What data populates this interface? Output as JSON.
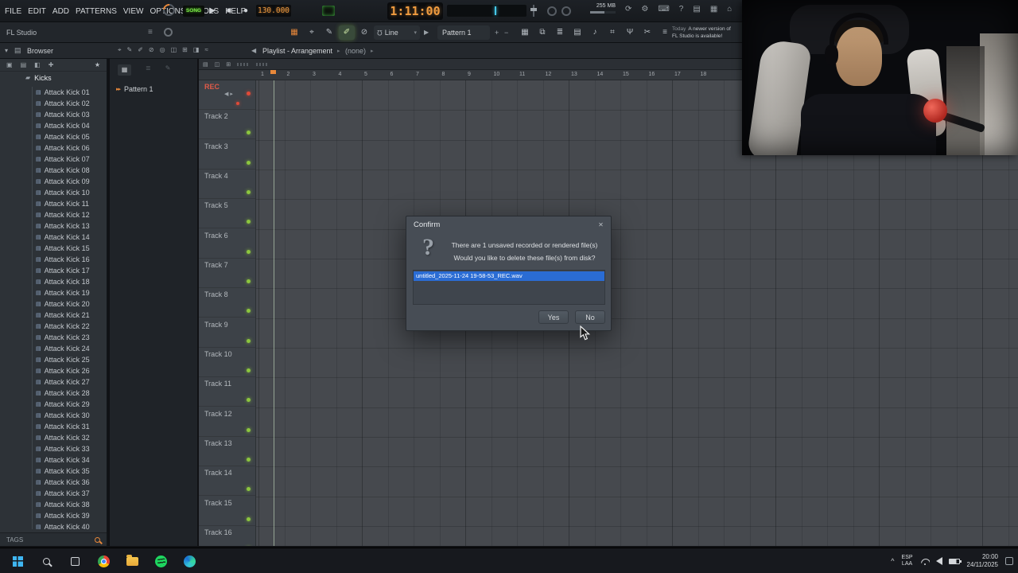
{
  "app": {
    "title": "FL Studio"
  },
  "menu": {
    "items": [
      "FILE",
      "EDIT",
      "ADD",
      "PATTERNS",
      "VIEW",
      "OPTIONS",
      "TOOLS",
      "HELP"
    ]
  },
  "transport": {
    "mode_label": "SONG",
    "play_icon": "▶",
    "stop_icon": "■",
    "record_icon": "●",
    "tempo": "130.000",
    "time": "1:11:00",
    "memory": "255 MB",
    "mini_icons": [
      {
        "name": "wave-icon",
        "glyph": "≈"
      },
      {
        "name": "keyboard-panel-icon",
        "glyph": "◧"
      },
      {
        "name": "metronome-icon",
        "glyph": "⌗"
      },
      {
        "name": "wait-icon",
        "glyph": "◆"
      }
    ],
    "right_icons": [
      {
        "name": "recycle-icon",
        "glyph": "⟳"
      },
      {
        "name": "settings-icon",
        "glyph": "⚙"
      },
      {
        "name": "typing-keyboard-icon",
        "glyph": "⌨"
      },
      {
        "name": "help-icon",
        "glyph": "?"
      },
      {
        "name": "manual-icon",
        "glyph": "▤"
      },
      {
        "name": "cpu-panel-icon",
        "glyph": "▦"
      },
      {
        "name": "online-icon",
        "glyph": "⌂"
      }
    ]
  },
  "toolbar": {
    "tools": [
      {
        "name": "grid-snap-icon",
        "glyph": "▦",
        "cls": "accent"
      },
      {
        "name": "cursor-tool-icon",
        "glyph": "⌖",
        "cls": ""
      },
      {
        "name": "pencil-tool-icon",
        "glyph": "✎",
        "cls": ""
      },
      {
        "name": "paint-tool-icon",
        "glyph": "✐",
        "cls": "selected"
      },
      {
        "name": "delete-tool-icon",
        "glyph": "⊘",
        "cls": ""
      }
    ],
    "snap_label": "Line",
    "snap_caret": "▾",
    "magnet_icon": "Ω",
    "mini_play_icon": "▶",
    "pattern_label": "Pattern 1",
    "plus_icon": "+",
    "minus_icon": "−",
    "panel_icons": [
      {
        "name": "playlist-panel-icon",
        "glyph": "▦"
      },
      {
        "name": "piano-roll-icon",
        "glyph": "⧉"
      },
      {
        "name": "channel-rack-icon",
        "glyph": "≣"
      },
      {
        "name": "mixer-icon",
        "glyph": "▤"
      },
      {
        "name": "browser-toggle-icon",
        "glyph": "♪"
      },
      {
        "name": "plugin-picker-icon",
        "glyph": "⌗"
      },
      {
        "name": "patcher-icon",
        "glyph": "Ψ"
      },
      {
        "name": "tools-icon",
        "glyph": "✂"
      },
      {
        "name": "more-icon",
        "glyph": "≡"
      }
    ],
    "notification": {
      "prefix": "Today",
      "line1": "A newer version of",
      "line2": "FL Studio is available!"
    }
  },
  "panelbar": {
    "caret_icon": "▾",
    "book_icon": "▤",
    "browser_label": "Browser",
    "playlist_tools": [
      {
        "name": "target-tool-icon",
        "glyph": "⌖"
      },
      {
        "name": "pencil-tool-icon",
        "glyph": "✎"
      },
      {
        "name": "brush-tool-icon",
        "glyph": "✐"
      },
      {
        "name": "delete-tool-icon",
        "glyph": "⊘"
      },
      {
        "name": "mute-tool-icon",
        "glyph": "◎"
      },
      {
        "name": "slip-tool-icon",
        "glyph": "◫"
      },
      {
        "name": "zoom-tool-icon",
        "glyph": "⊞"
      },
      {
        "name": "playback-tool-icon",
        "glyph": "◨"
      },
      {
        "name": "preview-tool-icon",
        "glyph": "≈"
      }
    ],
    "speaker_icon": "◀",
    "breadcrumb": "Playlist - Arrangement",
    "sep_icon": "▸",
    "breadcrumb_extra": "(none)"
  },
  "browser": {
    "tabs": [
      {
        "name": "browser-tab-all-icon",
        "glyph": "▣"
      },
      {
        "name": "browser-tab-files-icon",
        "glyph": "▤"
      },
      {
        "name": "browser-tab-plugins-icon",
        "glyph": "◧"
      },
      {
        "name": "browser-tab-add-icon",
        "glyph": "✚"
      }
    ],
    "star_icon": "★",
    "folder_icon": "▰",
    "folder": "Kicks",
    "file_icon": "▤",
    "items": [
      "Attack Kick 01",
      "Attack Kick 02",
      "Attack Kick 03",
      "Attack Kick 04",
      "Attack Kick 05",
      "Attack Kick 06",
      "Attack Kick 07",
      "Attack Kick 08",
      "Attack Kick 09",
      "Attack Kick 10",
      "Attack Kick 11",
      "Attack Kick 12",
      "Attack Kick 13",
      "Attack Kick 14",
      "Attack Kick 15",
      "Attack Kick 16",
      "Attack Kick 17",
      "Attack Kick 18",
      "Attack Kick 19",
      "Attack Kick 20",
      "Attack Kick 21",
      "Attack Kick 22",
      "Attack Kick 23",
      "Attack Kick 24",
      "Attack Kick 25",
      "Attack Kick 26",
      "Attack Kick 27",
      "Attack Kick 28",
      "Attack Kick 29",
      "Attack Kick 30",
      "Attack Kick 31",
      "Attack Kick 32",
      "Attack Kick 33",
      "Attack Kick 34",
      "Attack Kick 35",
      "Attack Kick 36",
      "Attack Kick 37",
      "Attack Kick 38",
      "Attack Kick 39",
      "Attack Kick 40"
    ],
    "tags_label": "TAGS"
  },
  "patterns": {
    "icons": [
      {
        "name": "pattern-grid-icon",
        "glyph": "▦"
      },
      {
        "name": "pattern-list-icon",
        "glyph": "≣"
      },
      {
        "name": "pattern-rename-icon",
        "glyph": "✎"
      }
    ],
    "arrows_icon": "▸▸",
    "current": "Pattern 1"
  },
  "playlist": {
    "header_icons": [
      {
        "name": "detach-icon",
        "glyph": "▤"
      },
      {
        "name": "marker-icon",
        "glyph": "◫"
      },
      {
        "name": "zoom-icon",
        "glyph": "⊞"
      }
    ],
    "rec_label": "REC",
    "rec_controls": "◀ ▸",
    "tracks": [
      "Track 2",
      "Track 3",
      "Track 4",
      "Track 5",
      "Track 6",
      "Track 7",
      "Track 8",
      "Track 9",
      "Track 10",
      "Track 11",
      "Track 12",
      "Track 13",
      "Track 14",
      "Track 15",
      "Track 16"
    ],
    "ruler_bars": [
      1,
      2,
      3,
      4,
      5,
      6,
      7,
      8,
      9,
      10,
      11,
      12,
      13,
      14,
      15,
      16,
      17,
      18
    ]
  },
  "dialog": {
    "title": "Confirm",
    "close_icon": "✕",
    "question_mark": "?",
    "line1": "There are 1 unsaved recorded or rendered file(s)",
    "line2": "Would you like to delete these file(s) from disk?",
    "file_name": "untitled_2025-11-24 19-58-53_REC.wav",
    "yes_label": "Yes",
    "no_label": "No"
  },
  "taskbar": {
    "apps": [
      {
        "name": "start-button",
        "cls": "start"
      },
      {
        "name": "search-button",
        "cls": "search"
      },
      {
        "name": "task-view-button",
        "cls": "task-view"
      },
      {
        "name": "chrome-button",
        "cls": "chrome"
      },
      {
        "name": "file-explorer-button",
        "cls": "file-explorer"
      },
      {
        "name": "spotify-button",
        "cls": "spotify"
      },
      {
        "name": "edge-button",
        "cls": "edge"
      }
    ],
    "hidden_icons_caret": "^",
    "tray": [
      "wifi",
      "volume",
      "battery"
    ],
    "lang_line1": "ESP",
    "lang_line2": "LAA",
    "time": "20:00",
    "date": "24/11/2025"
  }
}
